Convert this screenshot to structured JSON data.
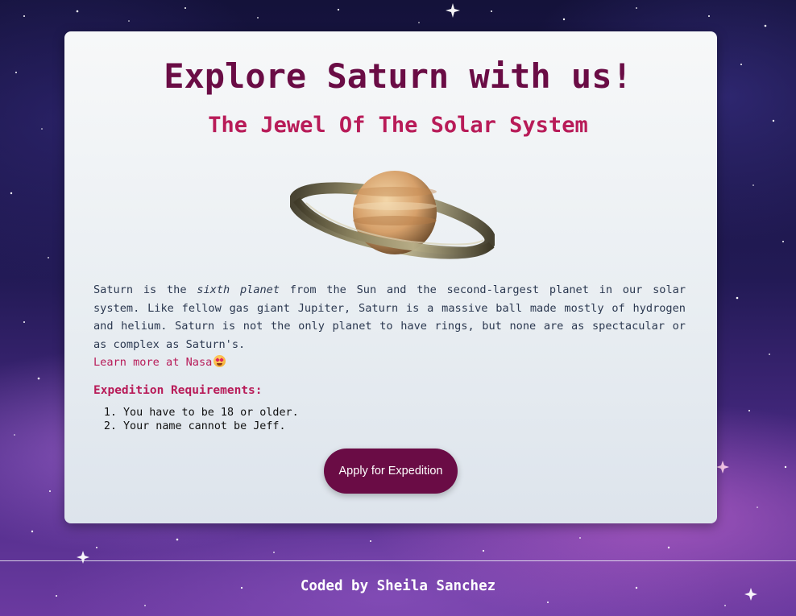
{
  "header": {
    "title": "Explore Saturn with us!",
    "subtitle": "The Jewel Of The Solar System"
  },
  "planet_image": {
    "icon": "saturn-image"
  },
  "description": {
    "text_before_em": "Saturn is the ",
    "emphasis": "sixth planet",
    "text_after_em": " from the Sun and the second-largest planet in our solar system. Like fellow gas giant Jupiter, Saturn is a massive ball made mostly of hydrogen and helium. Saturn is not the only planet to have rings, but none are as spectacular or as complex as Saturn's.",
    "link_label": "Learn more at Nasa",
    "link_icon": "star-struck-emoji-icon"
  },
  "requirements": {
    "heading": "Expedition Requirements:",
    "items": [
      "You have to be 18 or older.",
      "Your name cannot be Jeff."
    ]
  },
  "cta": {
    "apply_label": "Apply for Expedition"
  },
  "footer": {
    "credit": "Coded by Sheila Sanchez"
  },
  "colors": {
    "title": "#6a0c45",
    "accent": "#b81b58",
    "button_bg": "#6a0c45",
    "body_text": "#2b3850"
  }
}
